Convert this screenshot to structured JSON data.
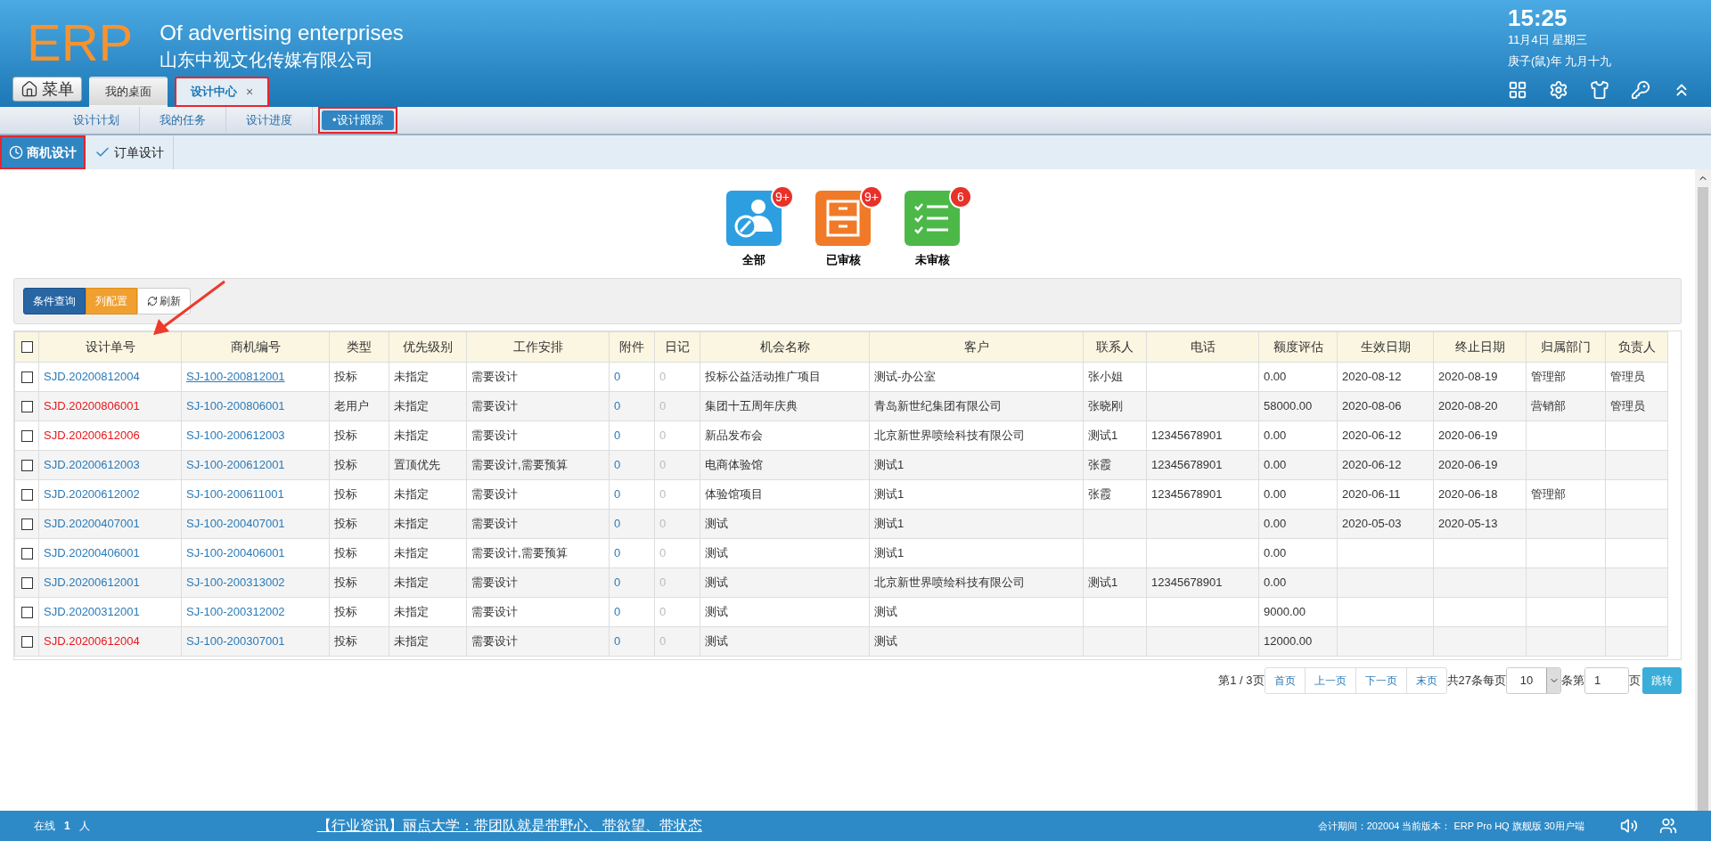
{
  "header": {
    "logo": "ERP",
    "subtitle": "Of advertising enterprises",
    "company": "山东中视文化传媒有限公司",
    "time": "15:25",
    "date": "11月4日 星期三",
    "lunar": "庚子(鼠)年 九月十九",
    "menu_button": "菜单"
  },
  "tabs": [
    {
      "label": "我的桌面",
      "selected": false,
      "closable": false,
      "highlighted": false
    },
    {
      "label": "设计中心",
      "selected": true,
      "closable": true,
      "highlighted": true
    }
  ],
  "close_mark": "×",
  "subnav": [
    {
      "label": "设计计划",
      "selected": false,
      "highlighted": false
    },
    {
      "label": "我的任务",
      "selected": false,
      "highlighted": false
    },
    {
      "label": "设计进度",
      "selected": false,
      "highlighted": false
    },
    {
      "label": "•设计跟踪",
      "selected": true,
      "highlighted": true
    }
  ],
  "page_tabs": [
    {
      "label": "商机设计",
      "kind": "clock",
      "selected": true,
      "highlighted": true
    },
    {
      "label": "订单设计",
      "kind": "check",
      "selected": false,
      "highlighted": false
    }
  ],
  "categories": [
    {
      "label": "全部",
      "kind": "person",
      "badge": "9+"
    },
    {
      "label": "已审核",
      "kind": "drawer",
      "badge": "9+"
    },
    {
      "label": "未审核",
      "kind": "list",
      "badge": "6"
    }
  ],
  "toolbar": [
    {
      "label": "条件查询",
      "kind": "primary"
    },
    {
      "label": "列配置",
      "kind": "warning"
    },
    {
      "label": "刷新",
      "kind": "refresh"
    }
  ],
  "table": {
    "columns": [
      "设计单号",
      "商机编号",
      "类型",
      "优先级别",
      "工作安排",
      "附件",
      "日记",
      "机会名称",
      "客户",
      "联系人",
      "电话",
      "额度评估",
      "生效日期",
      "终止日期",
      "归属部门",
      "负责人"
    ],
    "header_checked": false,
    "rows": [
      {
        "checked": false,
        "color": "#2a7ab8",
        "underlined": true,
        "design_no": "SJD.20200812004",
        "opportunity_no": "SJ-100-200812001",
        "type": "投标",
        "priority": "未指定",
        "work": "需要设计",
        "attachments": "0",
        "logs": "0",
        "name": "投标公益活动推广项目",
        "customer": "测试-办公室",
        "contact": "张小姐",
        "amount": "0.00",
        "start_date": "2020-08-12",
        "end_date": "2020-08-19",
        "department": "管理部",
        "owner": "管理员"
      },
      {
        "checked": false,
        "color": "#e8171b",
        "underlined": false,
        "design_no": "SJD.20200806001",
        "opportunity_no": "SJ-100-200806001",
        "type": "老用户",
        "priority": "未指定",
        "work": "需要设计",
        "attachments": "0",
        "logs": "0",
        "name": "集团十五周年庆典",
        "customer": "青岛新世纪集团有限公司",
        "contact": "张晓刚",
        "amount": "58000.00",
        "start_date": "2020-08-06",
        "end_date": "2020-08-20",
        "department": "营销部",
        "owner": "管理员"
      },
      {
        "checked": false,
        "color": "#e8171b",
        "underlined": false,
        "design_no": "SJD.20200612006",
        "opportunity_no": "SJ-100-200612003",
        "type": "投标",
        "priority": "未指定",
        "work": "需要设计",
        "attachments": "0",
        "logs": "0",
        "name": "新品发布会",
        "customer": "北京新世界喷绘科技有限公司",
        "contact": "测试1",
        "phone": "12345678901",
        "amount": "0.00",
        "start_date": "2020-06-12",
        "end_date": "2020-06-19"
      },
      {
        "checked": false,
        "color": "#2a7ab8",
        "underlined": false,
        "design_no": "SJD.20200612003",
        "opportunity_no": "SJ-100-200612001",
        "type": "投标",
        "priority": "置顶优先",
        "work": "需要设计,需要预算",
        "attachments": "0",
        "logs": "0",
        "name": "电商体验馆",
        "customer": "测试1",
        "contact": "张霞",
        "phone": "12345678901",
        "amount": "0.00",
        "start_date": "2020-06-12",
        "end_date": "2020-06-19"
      },
      {
        "checked": false,
        "color": "#2a7ab8",
        "underlined": false,
        "design_no": "SJD.20200612002",
        "opportunity_no": "SJ-100-200611001",
        "type": "投标",
        "priority": "未指定",
        "work": "需要设计",
        "attachments": "0",
        "logs": "0",
        "name": "体验馆项目",
        "customer": "测试1",
        "contact": "张霞",
        "phone": "12345678901",
        "amount": "0.00",
        "start_date": "2020-06-11",
        "end_date": "2020-06-18",
        "department": "管理部"
      },
      {
        "checked": false,
        "color": "#2a7ab8",
        "underlined": false,
        "design_no": "SJD.20200407001",
        "opportunity_no": "SJ-100-200407001",
        "type": "投标",
        "priority": "未指定",
        "work": "需要设计",
        "attachments": "0",
        "logs": "0",
        "name": "测试",
        "customer": "测试1",
        "amount": "0.00",
        "start_date": "2020-05-03",
        "end_date": "2020-05-13"
      },
      {
        "checked": false,
        "color": "#2a7ab8",
        "underlined": false,
        "design_no": "SJD.20200406001",
        "opportunity_no": "SJ-100-200406001",
        "type": "投标",
        "priority": "未指定",
        "work": "需要设计,需要预算",
        "attachments": "0",
        "logs": "0",
        "name": "测试",
        "customer": "测试1",
        "amount": "0.00"
      },
      {
        "checked": false,
        "color": "#2a7ab8",
        "underlined": false,
        "design_no": "SJD.20200612001",
        "opportunity_no": "SJ-100-200313002",
        "type": "投标",
        "priority": "未指定",
        "work": "需要设计",
        "attachments": "0",
        "logs": "0",
        "name": "测试",
        "customer": "北京新世界喷绘科技有限公司",
        "contact": "测试1",
        "phone": "12345678901",
        "amount": "0.00"
      },
      {
        "checked": false,
        "color": "#2a7ab8",
        "underlined": false,
        "design_no": "SJD.20200312001",
        "opportunity_no": "SJ-100-200312002",
        "type": "投标",
        "priority": "未指定",
        "work": "需要设计",
        "attachments": "0",
        "logs": "0",
        "name": "测试",
        "customer": "测试",
        "amount": "9000.00"
      },
      {
        "checked": false,
        "color": "#e8171b",
        "underlined": false,
        "design_no": "SJD.20200612004",
        "opportunity_no": "SJ-100-200307001",
        "type": "投标",
        "priority": "未指定",
        "work": "需要设计",
        "attachments": "0",
        "logs": "0",
        "name": "测试",
        "customer": "测试",
        "amount": "12000.00"
      }
    ]
  },
  "pagination": {
    "page_info": "第1 / 3页",
    "buttons": [
      "首页",
      "上一页",
      "下一页",
      "末页"
    ],
    "total": "共27条每页",
    "page_size": "10",
    "rows_label": "条第",
    "page_input": "1",
    "page_label": "页",
    "go_button": "跳转"
  },
  "status_bar": {
    "online_label": "在线",
    "online_count": "1",
    "online_unit": "人",
    "news": "【行业资讯】丽点大学：带团队就是带野心、带欲望、带状态",
    "info": "会计期间：202004 当前版本： ERP Pro HQ 旗舰版 30用户端"
  }
}
